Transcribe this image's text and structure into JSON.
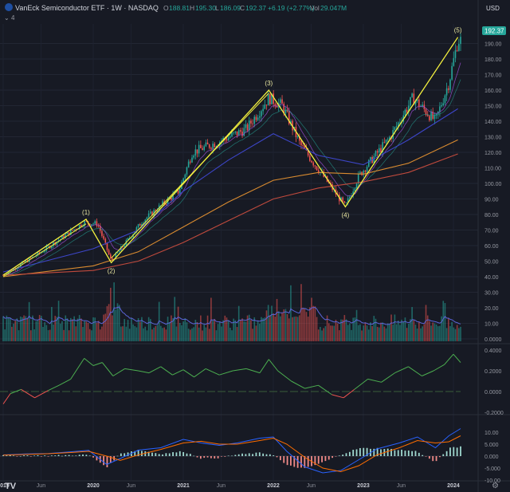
{
  "header": {
    "symbol_icon_color": "#1e4fa3",
    "title": "VanEck Semiconductor ETF · 1W · NASDAQ",
    "ohlc": [
      {
        "label": "O",
        "value": "188.81"
      },
      {
        "label": "H",
        "value": "195.30"
      },
      {
        "label": "L",
        "value": "186.09"
      },
      {
        "label": "C",
        "value": "192.37"
      }
    ],
    "change": "+6.19 (+2.77%)",
    "vol_label": "Vol",
    "vol_value": "29.047M",
    "indicator_count": "4",
    "currency": "USD",
    "last_price": "192.37"
  },
  "colors": {
    "up": "#26a69a",
    "down": "#ef5350",
    "wave": "#f5f23f",
    "ma_fast": "#9c4fd6",
    "ma_blue": "#3d46c9",
    "ma_orange": "#d98b30",
    "ma_red": "#c04a3d",
    "osc_up": "#4caf50",
    "osc_down": "#ef5350",
    "macd": "#2962ff",
    "signal": "#ff6d00"
  },
  "chart_data": [
    {
      "type": "candlestick",
      "title": "VanEck Semiconductor ETF · 1W · NASDAQ",
      "ylim": [
        0,
        200
      ],
      "price_ticks": [
        "190.00",
        "180.00",
        "170.00",
        "160.00",
        "150.00",
        "140.00",
        "130.00",
        "120.00",
        "110.00",
        "100.00",
        "90.00",
        "80.00",
        "70.00",
        "60.00",
        "50.00",
        "40.00",
        "30.00",
        "20.00",
        "10.00",
        "0.0000"
      ],
      "x_labels": [
        "2019",
        "Jun",
        "2020",
        "Jun",
        "2021",
        "Jun",
        "2022",
        "Jun",
        "2023",
        "Jun",
        "2024"
      ],
      "price_path": [
        {
          "x": 2019.0,
          "y": 41
        },
        {
          "x": 2019.4,
          "y": 55
        },
        {
          "x": 2019.9,
          "y": 75
        },
        {
          "x": 2020.05,
          "y": 74
        },
        {
          "x": 2020.2,
          "y": 50
        },
        {
          "x": 2020.55,
          "y": 76
        },
        {
          "x": 2020.95,
          "y": 95
        },
        {
          "x": 2021.1,
          "y": 120
        },
        {
          "x": 2021.4,
          "y": 127
        },
        {
          "x": 2021.7,
          "y": 135
        },
        {
          "x": 2021.95,
          "y": 155
        },
        {
          "x": 2022.1,
          "y": 150
        },
        {
          "x": 2022.3,
          "y": 125
        },
        {
          "x": 2022.55,
          "y": 105
        },
        {
          "x": 2022.8,
          "y": 85
        },
        {
          "x": 2022.95,
          "y": 105
        },
        {
          "x": 2023.3,
          "y": 130
        },
        {
          "x": 2023.55,
          "y": 155
        },
        {
          "x": 2023.8,
          "y": 140
        },
        {
          "x": 2023.95,
          "y": 165
        },
        {
          "x": 2024.05,
          "y": 192
        }
      ],
      "moving_averages": [
        {
          "key": "ma_blue",
          "points": [
            [
              2019.0,
              43
            ],
            [
              2020.0,
              58
            ],
            [
              2020.5,
              70
            ],
            [
              2021.0,
              95
            ],
            [
              2021.5,
              115
            ],
            [
              2022.0,
              132
            ],
            [
              2022.5,
              118
            ],
            [
              2023.0,
              112
            ],
            [
              2023.5,
              128
            ],
            [
              2024.05,
              148
            ]
          ]
        },
        {
          "key": "ma_orange",
          "points": [
            [
              2019.0,
              40
            ],
            [
              2020.0,
              47
            ],
            [
              2020.5,
              56
            ],
            [
              2021.0,
              72
            ],
            [
              2021.5,
              88
            ],
            [
              2022.0,
              102
            ],
            [
              2022.5,
              107
            ],
            [
              2023.0,
              106
            ],
            [
              2023.5,
              113
            ],
            [
              2024.05,
              128
            ]
          ]
        },
        {
          "key": "ma_red",
          "points": [
            [
              2019.0,
              41
            ],
            [
              2020.0,
              44
            ],
            [
              2020.5,
              50
            ],
            [
              2021.0,
              62
            ],
            [
              2021.5,
              76
            ],
            [
              2022.0,
              90
            ],
            [
              2022.5,
              97
            ],
            [
              2023.0,
              101
            ],
            [
              2023.5,
              107
            ],
            [
              2024.05,
              119
            ]
          ]
        }
      ],
      "wave_points": [
        {
          "label": "(1)",
          "x": 2019.92,
          "y": 77
        },
        {
          "label": "(2)",
          "x": 2020.2,
          "y": 49
        },
        {
          "label": "(3)",
          "x": 2021.95,
          "y": 160
        },
        {
          "label": "(4)",
          "x": 2022.8,
          "y": 85
        },
        {
          "label": "(5)",
          "x": 2024.05,
          "y": 194
        }
      ],
      "wave_start": {
        "x": 2019.0,
        "y": 41
      }
    },
    {
      "type": "bar",
      "name": "Volume",
      "ylim": [
        0,
        45
      ]
    },
    {
      "type": "line",
      "name": "Oscillator",
      "y_ticks": [
        "0.4000",
        "0.2000",
        "0.0000",
        "-0.2000"
      ],
      "ylim": [
        -0.2,
        0.4
      ],
      "points": [
        [
          2019.0,
          -0.12
        ],
        [
          2019.08,
          -0.02
        ],
        [
          2019.2,
          0.02
        ],
        [
          2019.35,
          -0.06
        ],
        [
          2019.5,
          0.01
        ],
        [
          2019.62,
          0.06
        ],
        [
          2019.75,
          0.12
        ],
        [
          2019.9,
          0.32
        ],
        [
          2020.0,
          0.25
        ],
        [
          2020.1,
          0.28
        ],
        [
          2020.22,
          0.15
        ],
        [
          2020.35,
          0.22
        ],
        [
          2020.5,
          0.2
        ],
        [
          2020.62,
          0.18
        ],
        [
          2020.75,
          0.24
        ],
        [
          2020.88,
          0.16
        ],
        [
          2021.0,
          0.21
        ],
        [
          2021.12,
          0.14
        ],
        [
          2021.25,
          0.22
        ],
        [
          2021.4,
          0.16
        ],
        [
          2021.55,
          0.2
        ],
        [
          2021.7,
          0.22
        ],
        [
          2021.85,
          0.18
        ],
        [
          2021.95,
          0.31
        ],
        [
          2022.05,
          0.2
        ],
        [
          2022.2,
          0.1
        ],
        [
          2022.35,
          0.03
        ],
        [
          2022.5,
          0.06
        ],
        [
          2022.65,
          -0.03
        ],
        [
          2022.78,
          -0.06
        ],
        [
          2022.9,
          0.02
        ],
        [
          2023.05,
          0.12
        ],
        [
          2023.2,
          0.09
        ],
        [
          2023.35,
          0.18
        ],
        [
          2023.5,
          0.24
        ],
        [
          2023.65,
          0.15
        ],
        [
          2023.78,
          0.2
        ],
        [
          2023.9,
          0.26
        ],
        [
          2024.0,
          0.36
        ],
        [
          2024.08,
          0.28
        ]
      ]
    },
    {
      "type": "macd",
      "name": "MACD",
      "y_ticks": [
        "10.00",
        "5.000",
        "0.000",
        "-5.000",
        "-10.00"
      ],
      "ylim": [
        -10,
        15
      ],
      "macd": [
        [
          2019.0,
          0.5
        ],
        [
          2019.25,
          0.9
        ],
        [
          2019.5,
          1.1
        ],
        [
          2019.75,
          1.8
        ],
        [
          2019.95,
          2.4
        ],
        [
          2020.15,
          -3.5
        ],
        [
          2020.3,
          -1.0
        ],
        [
          2020.5,
          2.5
        ],
        [
          2020.75,
          3.5
        ],
        [
          2021.0,
          7.0
        ],
        [
          2021.2,
          5.5
        ],
        [
          2021.4,
          4.5
        ],
        [
          2021.6,
          5.5
        ],
        [
          2021.85,
          7.5
        ],
        [
          2022.0,
          8.0
        ],
        [
          2022.15,
          2.0
        ],
        [
          2022.35,
          -4.5
        ],
        [
          2022.55,
          -7.0
        ],
        [
          2022.75,
          -6.0
        ],
        [
          2022.95,
          -1.5
        ],
        [
          2023.15,
          3.0
        ],
        [
          2023.4,
          5.5
        ],
        [
          2023.6,
          8.0
        ],
        [
          2023.8,
          3.5
        ],
        [
          2023.95,
          8.5
        ],
        [
          2024.08,
          11.5
        ]
      ],
      "signal": [
        [
          2019.0,
          0.4
        ],
        [
          2019.25,
          0.7
        ],
        [
          2019.5,
          1.0
        ],
        [
          2019.75,
          1.5
        ],
        [
          2019.95,
          2.0
        ],
        [
          2020.15,
          0.0
        ],
        [
          2020.3,
          -1.8
        ],
        [
          2020.5,
          0.5
        ],
        [
          2020.75,
          2.8
        ],
        [
          2021.0,
          5.5
        ],
        [
          2021.2,
          6.2
        ],
        [
          2021.4,
          5.0
        ],
        [
          2021.6,
          5.0
        ],
        [
          2021.85,
          6.5
        ],
        [
          2022.0,
          7.5
        ],
        [
          2022.15,
          5.0
        ],
        [
          2022.35,
          -0.5
        ],
        [
          2022.55,
          -5.0
        ],
        [
          2022.75,
          -6.5
        ],
        [
          2022.95,
          -4.0
        ],
        [
          2023.15,
          0.5
        ],
        [
          2023.4,
          3.5
        ],
        [
          2023.6,
          6.5
        ],
        [
          2023.8,
          5.5
        ],
        [
          2023.95,
          6.0
        ],
        [
          2024.08,
          8.5
        ]
      ]
    }
  ]
}
